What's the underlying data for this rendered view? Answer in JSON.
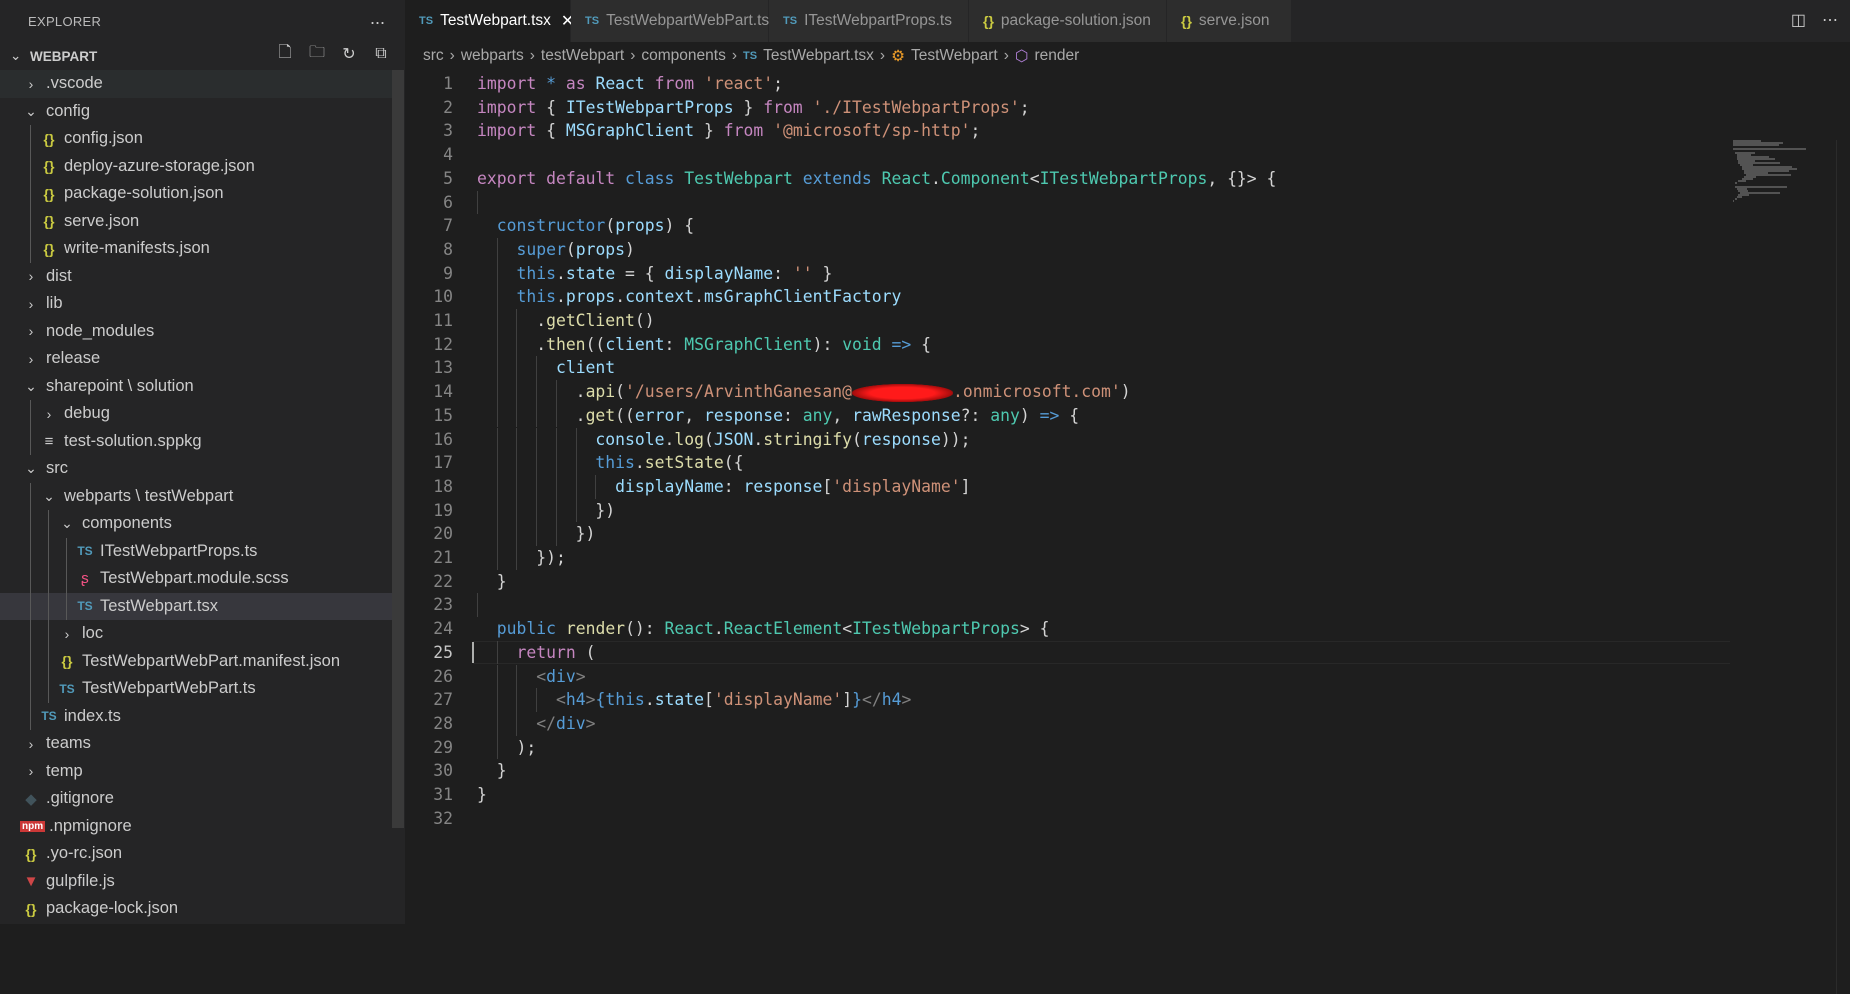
{
  "explorer": {
    "title": "EXPLORER",
    "more_label": "...",
    "project": "WEBPART",
    "tree": [
      {
        "label": ".vscode",
        "depth": 0,
        "icon": "chevron-right",
        "hover": true
      },
      {
        "label": "config",
        "depth": 0,
        "icon": "chevron-down"
      },
      {
        "label": "config.json",
        "depth": 1,
        "icon": "json"
      },
      {
        "label": "deploy-azure-storage.json",
        "depth": 1,
        "icon": "json"
      },
      {
        "label": "package-solution.json",
        "depth": 1,
        "icon": "json"
      },
      {
        "label": "serve.json",
        "depth": 1,
        "icon": "json"
      },
      {
        "label": "write-manifests.json",
        "depth": 1,
        "icon": "json"
      },
      {
        "label": "dist",
        "depth": 0,
        "icon": "chevron-right"
      },
      {
        "label": "lib",
        "depth": 0,
        "icon": "chevron-right"
      },
      {
        "label": "node_modules",
        "depth": 0,
        "icon": "chevron-right"
      },
      {
        "label": "release",
        "depth": 0,
        "icon": "chevron-right"
      },
      {
        "label": "sharepoint \\ solution",
        "depth": 0,
        "icon": "chevron-down"
      },
      {
        "label": "debug",
        "depth": 1,
        "icon": "chevron-right"
      },
      {
        "label": "test-solution.sppkg",
        "depth": 1,
        "icon": "package"
      },
      {
        "label": "src",
        "depth": 0,
        "icon": "chevron-down"
      },
      {
        "label": "webparts \\ testWebpart",
        "depth": 1,
        "icon": "chevron-down"
      },
      {
        "label": "components",
        "depth": 2,
        "icon": "chevron-down"
      },
      {
        "label": "ITestWebpartProps.ts",
        "depth": 3,
        "icon": "ts"
      },
      {
        "label": "TestWebpart.module.scss",
        "depth": 3,
        "icon": "scss"
      },
      {
        "label": "TestWebpart.tsx",
        "depth": 3,
        "icon": "ts",
        "selected": true
      },
      {
        "label": "loc",
        "depth": 2,
        "icon": "chevron-right"
      },
      {
        "label": "TestWebpartWebPart.manifest.json",
        "depth": 2,
        "icon": "json"
      },
      {
        "label": "TestWebpartWebPart.ts",
        "depth": 2,
        "icon": "ts"
      },
      {
        "label": "index.ts",
        "depth": 1,
        "icon": "ts"
      },
      {
        "label": "teams",
        "depth": 0,
        "icon": "chevron-right"
      },
      {
        "label": "temp",
        "depth": 0,
        "icon": "chevron-right"
      },
      {
        "label": ".gitignore",
        "depth": 0,
        "icon": "git"
      },
      {
        "label": ".npmignore",
        "depth": 0,
        "icon": "npm"
      },
      {
        "label": ".yo-rc.json",
        "depth": 0,
        "icon": "json"
      },
      {
        "label": "gulpfile.js",
        "depth": 0,
        "icon": "gulp"
      },
      {
        "label": "package-lock.json",
        "depth": 0,
        "icon": "json"
      }
    ]
  },
  "tabs": [
    {
      "label": "TestWebpart.tsx",
      "icon": "ts",
      "active": true
    },
    {
      "label": "TestWebpartWebPart.ts",
      "icon": "ts"
    },
    {
      "label": "ITestWebpartProps.ts",
      "icon": "ts"
    },
    {
      "label": "package-solution.json",
      "icon": "json"
    },
    {
      "label": "serve.json",
      "icon": "json"
    }
  ],
  "breadcrumb": [
    "src",
    "webparts",
    "testWebpart",
    "components",
    "TestWebpart.tsx",
    "TestWebpart",
    "render"
  ],
  "editor": {
    "current_line": 25,
    "lines": [
      [
        [
          "import",
          "kw"
        ],
        [
          " * ",
          "st"
        ],
        [
          "as",
          "kw"
        ],
        [
          " React ",
          "var"
        ],
        [
          "from",
          "kw"
        ],
        [
          " ",
          "pl"
        ],
        [
          "'react'",
          "str"
        ],
        [
          ";",
          "pl"
        ]
      ],
      [
        [
          "import",
          "kw"
        ],
        [
          " { ",
          "pl"
        ],
        [
          "ITestWebpartProps",
          "var"
        ],
        [
          " } ",
          "pl"
        ],
        [
          "from",
          "kw"
        ],
        [
          " ",
          "pl"
        ],
        [
          "'./ITestWebpartProps'",
          "str"
        ],
        [
          ";",
          "pl"
        ]
      ],
      [
        [
          "import",
          "kw"
        ],
        [
          " { ",
          "pl"
        ],
        [
          "MSGraphClient",
          "var"
        ],
        [
          " } ",
          "pl"
        ],
        [
          "from",
          "kw"
        ],
        [
          " ",
          "pl"
        ],
        [
          "'@microsoft/sp-http'",
          "str"
        ],
        [
          ";",
          "pl"
        ]
      ],
      [],
      [
        [
          "export",
          "kw"
        ],
        [
          " ",
          "pl"
        ],
        [
          "default",
          "kw"
        ],
        [
          " ",
          "pl"
        ],
        [
          "class",
          "st"
        ],
        [
          " ",
          "pl"
        ],
        [
          "TestWebpart",
          "ty"
        ],
        [
          " ",
          "pl"
        ],
        [
          "extends",
          "st"
        ],
        [
          " ",
          "pl"
        ],
        [
          "React",
          "ty"
        ],
        [
          ".",
          "pl"
        ],
        [
          "Component",
          "ty"
        ],
        [
          "<",
          "pl"
        ],
        [
          "ITestWebpartProps",
          "ty"
        ],
        [
          ", {}> {",
          "pl"
        ]
      ],
      [],
      [
        [
          "  ",
          "pl"
        ],
        [
          "constructor",
          "st"
        ],
        [
          "(",
          "pl"
        ],
        [
          "props",
          "var"
        ],
        [
          ") {",
          "pl"
        ]
      ],
      [
        [
          "    ",
          "pl"
        ],
        [
          "super",
          "st"
        ],
        [
          "(",
          "pl"
        ],
        [
          "props",
          "var"
        ],
        [
          ")",
          "pl"
        ]
      ],
      [
        [
          "    ",
          "pl"
        ],
        [
          "this",
          "st"
        ],
        [
          ".",
          "pl"
        ],
        [
          "state",
          "var"
        ],
        [
          " = { ",
          "pl"
        ],
        [
          "displayName",
          "var"
        ],
        [
          ": ",
          "pl"
        ],
        [
          "''",
          "str"
        ],
        [
          " }",
          "pl"
        ]
      ],
      [
        [
          "    ",
          "pl"
        ],
        [
          "this",
          "st"
        ],
        [
          ".",
          "pl"
        ],
        [
          "props",
          "var"
        ],
        [
          ".",
          "pl"
        ],
        [
          "context",
          "var"
        ],
        [
          ".",
          "pl"
        ],
        [
          "msGraphClientFactory",
          "var"
        ]
      ],
      [
        [
          "      .",
          "pl"
        ],
        [
          "getClient",
          "fn"
        ],
        [
          "()",
          "pl"
        ]
      ],
      [
        [
          "      .",
          "pl"
        ],
        [
          "then",
          "fn"
        ],
        [
          "((",
          "pl"
        ],
        [
          "client",
          "var"
        ],
        [
          ": ",
          "pl"
        ],
        [
          "MSGraphClient",
          "ty"
        ],
        [
          "): ",
          "pl"
        ],
        [
          "void",
          "ty"
        ],
        [
          " ",
          "pl"
        ],
        [
          "=>",
          "st"
        ],
        [
          " {",
          "pl"
        ]
      ],
      [
        [
          "        ",
          "pl"
        ],
        [
          "client",
          "var"
        ]
      ],
      [
        [
          "          .",
          "pl"
        ],
        [
          "api",
          "fn"
        ],
        [
          "(",
          "pl"
        ],
        [
          "'/users/ArvinthGanesan@",
          "str"
        ],
        [
          "",
          "redact"
        ],
        [
          ".onmicrosoft.com'",
          "str"
        ],
        [
          ")",
          "pl"
        ]
      ],
      [
        [
          "          .",
          "pl"
        ],
        [
          "get",
          "fn"
        ],
        [
          "((",
          "pl"
        ],
        [
          "error",
          "var"
        ],
        [
          ", ",
          "pl"
        ],
        [
          "response",
          "var"
        ],
        [
          ": ",
          "pl"
        ],
        [
          "any",
          "ty"
        ],
        [
          ", ",
          "pl"
        ],
        [
          "rawResponse",
          "var"
        ],
        [
          "?: ",
          "pl"
        ],
        [
          "any",
          "ty"
        ],
        [
          ") ",
          "pl"
        ],
        [
          "=>",
          "st"
        ],
        [
          " {",
          "pl"
        ]
      ],
      [
        [
          "            ",
          "pl"
        ],
        [
          "console",
          "var"
        ],
        [
          ".",
          "pl"
        ],
        [
          "log",
          "fn"
        ],
        [
          "(",
          "pl"
        ],
        [
          "JSON",
          "var"
        ],
        [
          ".",
          "pl"
        ],
        [
          "stringify",
          "fn"
        ],
        [
          "(",
          "pl"
        ],
        [
          "response",
          "var"
        ],
        [
          "));",
          "pl"
        ]
      ],
      [
        [
          "            ",
          "pl"
        ],
        [
          "this",
          "st"
        ],
        [
          ".",
          "pl"
        ],
        [
          "setState",
          "fn"
        ],
        [
          "({",
          "pl"
        ]
      ],
      [
        [
          "              ",
          "pl"
        ],
        [
          "displayName",
          "var"
        ],
        [
          ": ",
          "pl"
        ],
        [
          "response",
          "var"
        ],
        [
          "[",
          "pl"
        ],
        [
          "'displayName'",
          "str"
        ],
        [
          "]",
          "pl"
        ]
      ],
      [
        [
          "            })",
          "pl"
        ]
      ],
      [
        [
          "          })",
          "pl"
        ]
      ],
      [
        [
          "      });",
          "pl"
        ]
      ],
      [
        [
          "  }",
          "pl"
        ]
      ],
      [],
      [
        [
          "  ",
          "pl"
        ],
        [
          "public",
          "st"
        ],
        [
          " ",
          "pl"
        ],
        [
          "render",
          "fn"
        ],
        [
          "(): ",
          "pl"
        ],
        [
          "React",
          "ty"
        ],
        [
          ".",
          "pl"
        ],
        [
          "ReactElement",
          "ty"
        ],
        [
          "<",
          "pl"
        ],
        [
          "ITestWebpartProps",
          "ty"
        ],
        [
          "> {",
          "pl"
        ]
      ],
      [
        [
          "    ",
          "pl"
        ],
        [
          "return",
          "kw"
        ],
        [
          " (",
          "pl"
        ]
      ],
      [
        [
          "      ",
          "pl"
        ],
        [
          "<",
          "tag"
        ],
        [
          "div",
          "st"
        ],
        [
          ">",
          "tag"
        ]
      ],
      [
        [
          "        ",
          "pl"
        ],
        [
          "<",
          "tag"
        ],
        [
          "h4",
          "st"
        ],
        [
          ">",
          "tag"
        ],
        [
          "{",
          "st"
        ],
        [
          "this",
          "st"
        ],
        [
          ".",
          "pl"
        ],
        [
          "state",
          "var"
        ],
        [
          "[",
          "pl"
        ],
        [
          "'displayName'",
          "str"
        ],
        [
          "]",
          "pl"
        ],
        [
          "}",
          "st"
        ],
        [
          "</",
          "tag"
        ],
        [
          "h4",
          "st"
        ],
        [
          ">",
          "tag"
        ]
      ],
      [
        [
          "      ",
          "pl"
        ],
        [
          "</",
          "tag"
        ],
        [
          "div",
          "st"
        ],
        [
          ">",
          "tag"
        ]
      ],
      [
        [
          "    );",
          "pl"
        ]
      ],
      [
        [
          "  }",
          "pl"
        ]
      ],
      [
        [
          "}",
          "pl"
        ]
      ],
      []
    ]
  },
  "colors": {
    "accent": "#007acc",
    "ts_icon": "#519aba",
    "json_icon": "#cbcb41"
  }
}
